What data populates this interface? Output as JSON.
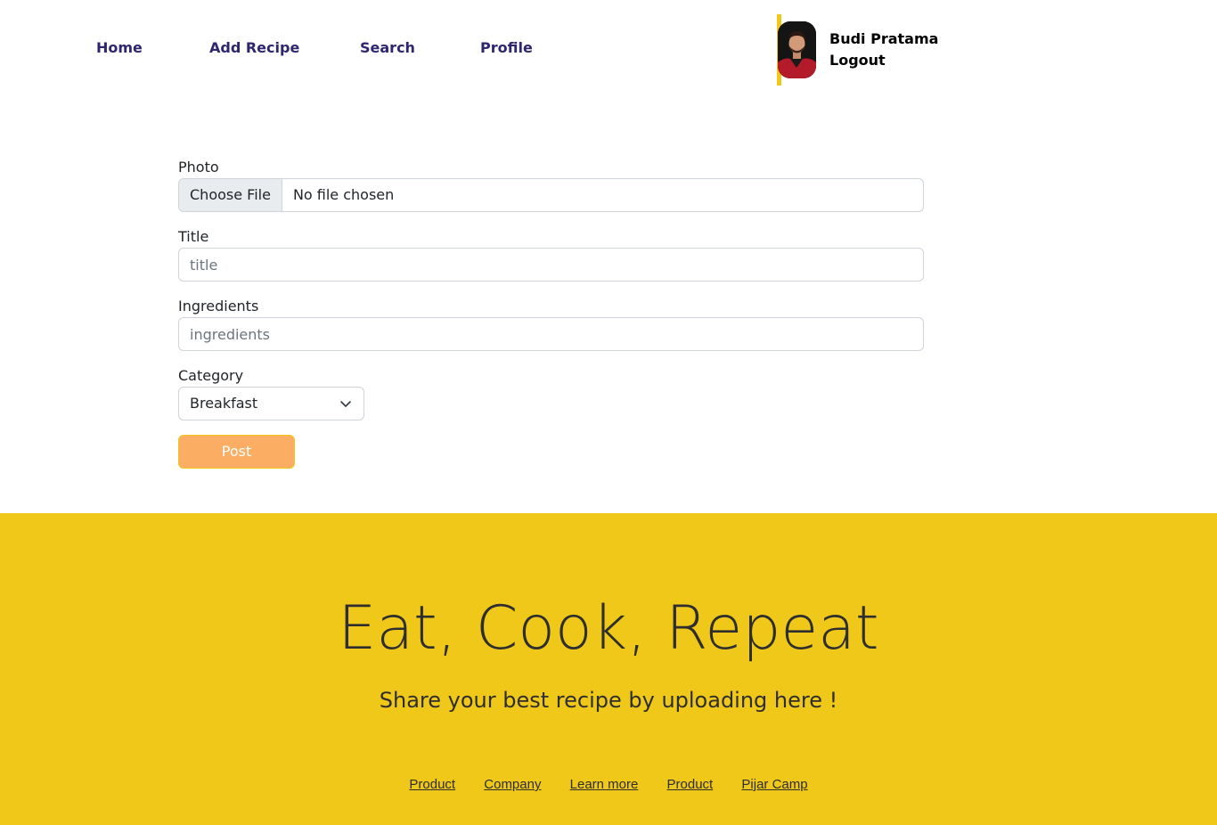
{
  "nav": {
    "links": [
      "Home",
      "Add Recipe",
      "Search",
      "Profile"
    ]
  },
  "user": {
    "name": "Budi Pratama",
    "logout": "Logout"
  },
  "form": {
    "photo_label": "Photo",
    "file_button": "Choose File",
    "file_status": "No file chosen",
    "title_label": "Title",
    "title_placeholder": "title",
    "ingredients_label": "Ingredients",
    "ingredients_placeholder": "ingredients",
    "category_label": "Category",
    "category_selected": "Breakfast",
    "post_label": "Post"
  },
  "footer": {
    "title": "Eat, Cook, Repeat",
    "subtitle": "Share your best recipe by uploading here !",
    "links": [
      "Product",
      "Company",
      "Learn more",
      "Product",
      "Pijar Camp"
    ]
  },
  "colors": {
    "accent_yellow": "#efc81a",
    "nav_text": "#2e266f",
    "post_button": "#fbae63"
  }
}
